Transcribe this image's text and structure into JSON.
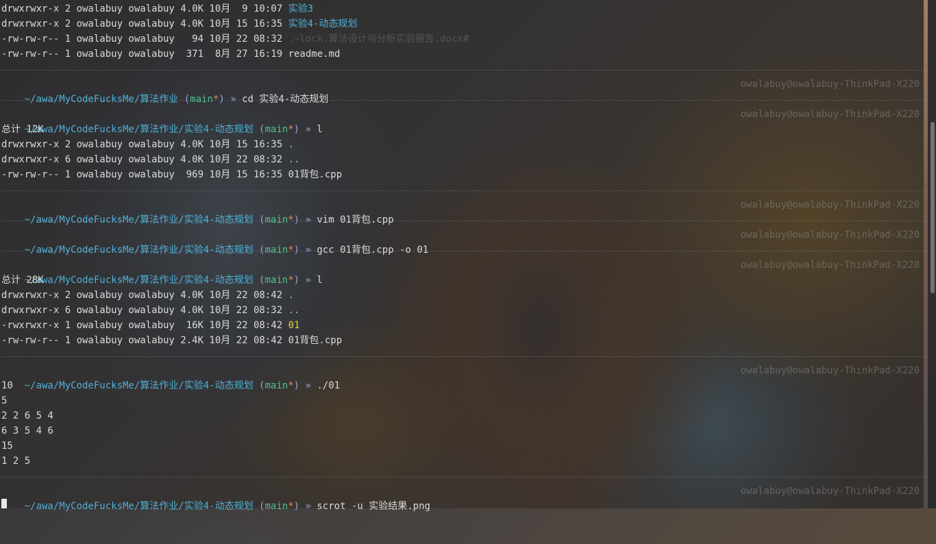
{
  "host": "owalabuy@owalabuy-ThinkPad-X220",
  "ls_top": [
    {
      "perms": "drwxrwxr-x 2 owalabuy owalabuy 4.0K 10月  9 10:07 ",
      "name": "实验3",
      "kind": "dir"
    },
    {
      "perms": "drwxrwxr-x 2 owalabuy owalabuy 4.0K 10月 15 16:35 ",
      "name": "实验4-动态规划",
      "kind": "dir"
    },
    {
      "perms": "-rw-rw-r-- 1 owalabuy owalabuy   94 10月 22 08:32 ",
      "name": ".~lock.算法设计与分析实验报告.docx#",
      "kind": "ghost"
    },
    {
      "perms": "-rw-rw-r-- 1 owalabuy owalabuy  371  8月 27 16:19 ",
      "name": "readme.md",
      "kind": "file"
    }
  ],
  "prompt": {
    "path_root": "~/awa/MyCodeFucksMe/算法作业",
    "path_sub": "~/awa/MyCodeFucksMe/算法作业/实验4-动态规划",
    "branch_open": "(",
    "branch": "main",
    "star": "*",
    "branch_close": ")",
    "arrow": "»"
  },
  "cmd1": "cd 实验4-动态规划",
  "cmd2": "l",
  "total1": "总计 12K",
  "ls2": [
    {
      "perms": "drwxrwxr-x 2 owalabuy owalabuy 4.0K 10月 15 16:35 ",
      "name": ".",
      "kind": "file"
    },
    {
      "perms": "drwxrwxr-x 6 owalabuy owalabuy 4.0K 10月 22 08:32 ",
      "name": "..",
      "kind": "file"
    },
    {
      "perms": "-rw-rw-r-- 1 owalabuy owalabuy  969 10月 15 16:35 ",
      "name": "01背包.cpp",
      "kind": "file"
    }
  ],
  "cmd3": "vim 01背包.cpp",
  "cmd4": "gcc 01背包.cpp -o 01",
  "cmd5": "l",
  "total2": "总计 28K",
  "ls3": [
    {
      "perms": "drwxrwxr-x 2 owalabuy owalabuy 4.0K 10月 22 08:42 ",
      "name": ".",
      "kind": "file"
    },
    {
      "perms": "drwxrwxr-x 6 owalabuy owalabuy 4.0K 10月 22 08:32 ",
      "name": "..",
      "kind": "file"
    },
    {
      "perms": "-rwxrwxr-x 1 owalabuy owalabuy  16K 10月 22 08:42 ",
      "name": "01",
      "kind": "exec"
    },
    {
      "perms": "-rw-rw-r-- 1 owalabuy owalabuy 2.4K 10月 22 08:42 ",
      "name": "01背包.cpp",
      "kind": "file"
    }
  ],
  "cmd6": "./01",
  "output": [
    "10",
    "5",
    "2 2 6 5 4",
    "6 3 5 4 6",
    "15",
    "1 2 5"
  ],
  "cmd7": "scrot -u 实验结果.png"
}
